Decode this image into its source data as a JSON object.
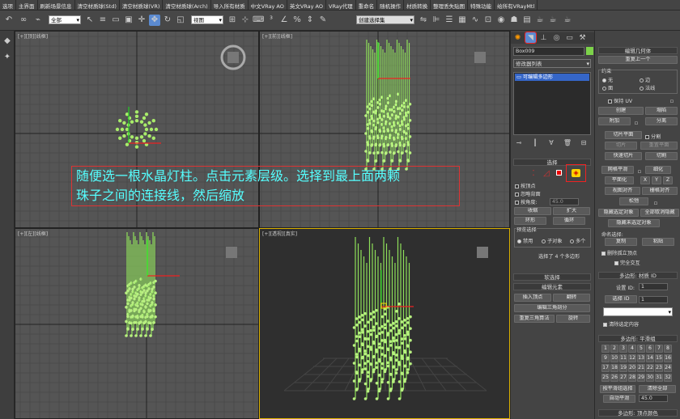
{
  "menu": [
    "选项",
    "主界面",
    "刷新场景信息",
    "清空材质球(Std)",
    "清空材质球(VR)",
    "清空材质球(Arch)",
    "导入所有材质",
    "中文VRay AO",
    "英文VRay AO",
    "VRay代理",
    "重命名",
    "随机操作",
    "材质转换",
    "整理丢失贴图",
    "特殊功能",
    "给所有VRayMtl"
  ],
  "toolbar": {
    "filter": "全部",
    "refsys": "视图",
    "named_sel": "创建选择集"
  },
  "viewports": {
    "top": "[+][顶][线框]",
    "front": "[+][前][线框]",
    "left": "[+][左][线框]",
    "persp": "[+][透视][真实]"
  },
  "annotation": {
    "line1": "随便选一根水晶灯柱。点击元素层级。选择到最上面两颗",
    "line2": "珠子之间的连接线，然后缩放"
  },
  "cmd": {
    "object_name": "Box009",
    "modifier_list": "修改器列表",
    "stack_item": "可编辑多边形",
    "sel_title": "选择",
    "by_vertex": "按顶点",
    "ignore_back": "忽略背面",
    "by_angle": "按角度:",
    "angle": "45.0",
    "shrink": "收缩",
    "grow": "扩大",
    "ring": "环形",
    "loop": "循环",
    "preview": "预览选择",
    "disabled": "禁用",
    "subobj": "子对象",
    "multi": "多个",
    "status": "选择了 4 个多边形",
    "soft": "软选择",
    "edit_elem": "编辑元素",
    "insert_vertex": "插入顶点",
    "flip": "翻转",
    "edit_tri": "编辑三角剖分",
    "retri": "重复三角算法",
    "turn": "旋转"
  },
  "cmd2": {
    "edit_geom": "编辑几何体",
    "repeat_last": "重复上一个",
    "constraint": "约束",
    "none": "无",
    "edge": "边",
    "face": "面",
    "normal": "法线",
    "preserve_uv": "保持 UV",
    "create": "创建",
    "collapse": "塌陷",
    "attach": "附加",
    "detach": "分离",
    "slice_plane": "切片平面",
    "split": "分割",
    "slice": "切片",
    "reset_plane": "重置平面",
    "quickslice": "快速切片",
    "cut": "切割",
    "meshsmooth": "网格平滑",
    "tessellate": "细化",
    "make_planar": "平面化",
    "x": "X",
    "y": "Y",
    "z": "Z",
    "view_align": "视图对齐",
    "grid_align": "栅格对齐",
    "relax": "松弛",
    "hide_sel": "隐藏选定对象",
    "unhide_all": "全部取消隐藏",
    "hide_unsel": "隐藏未选定对象",
    "named_sel": "命名选择:",
    "copy": "复制",
    "paste": "粘贴",
    "delete_iso": "删除孤立顶点",
    "full_interact": "完全交互",
    "mat_ids": "多边形: 材质 ID",
    "set_id": "设置 ID:",
    "sel_id": "选择 ID",
    "clear_sel": "清除选定内容",
    "smoothing": "多边形: 平滑组",
    "smooth_nums": [
      "1",
      "2",
      "3",
      "4",
      "5",
      "6",
      "7",
      "8",
      "9",
      "10",
      "11",
      "12",
      "13",
      "14",
      "15",
      "16",
      "17",
      "18",
      "19",
      "20",
      "21",
      "22",
      "23",
      "24",
      "25",
      "26",
      "27",
      "28",
      "29",
      "30",
      "31",
      "32"
    ],
    "sel_by_sg": "按平滑组选择",
    "clear_all": "清除全部",
    "autosmooth": "自动平滑",
    "as_value": "45.0",
    "vertex_colors": "多边形: 顶点颜色"
  }
}
